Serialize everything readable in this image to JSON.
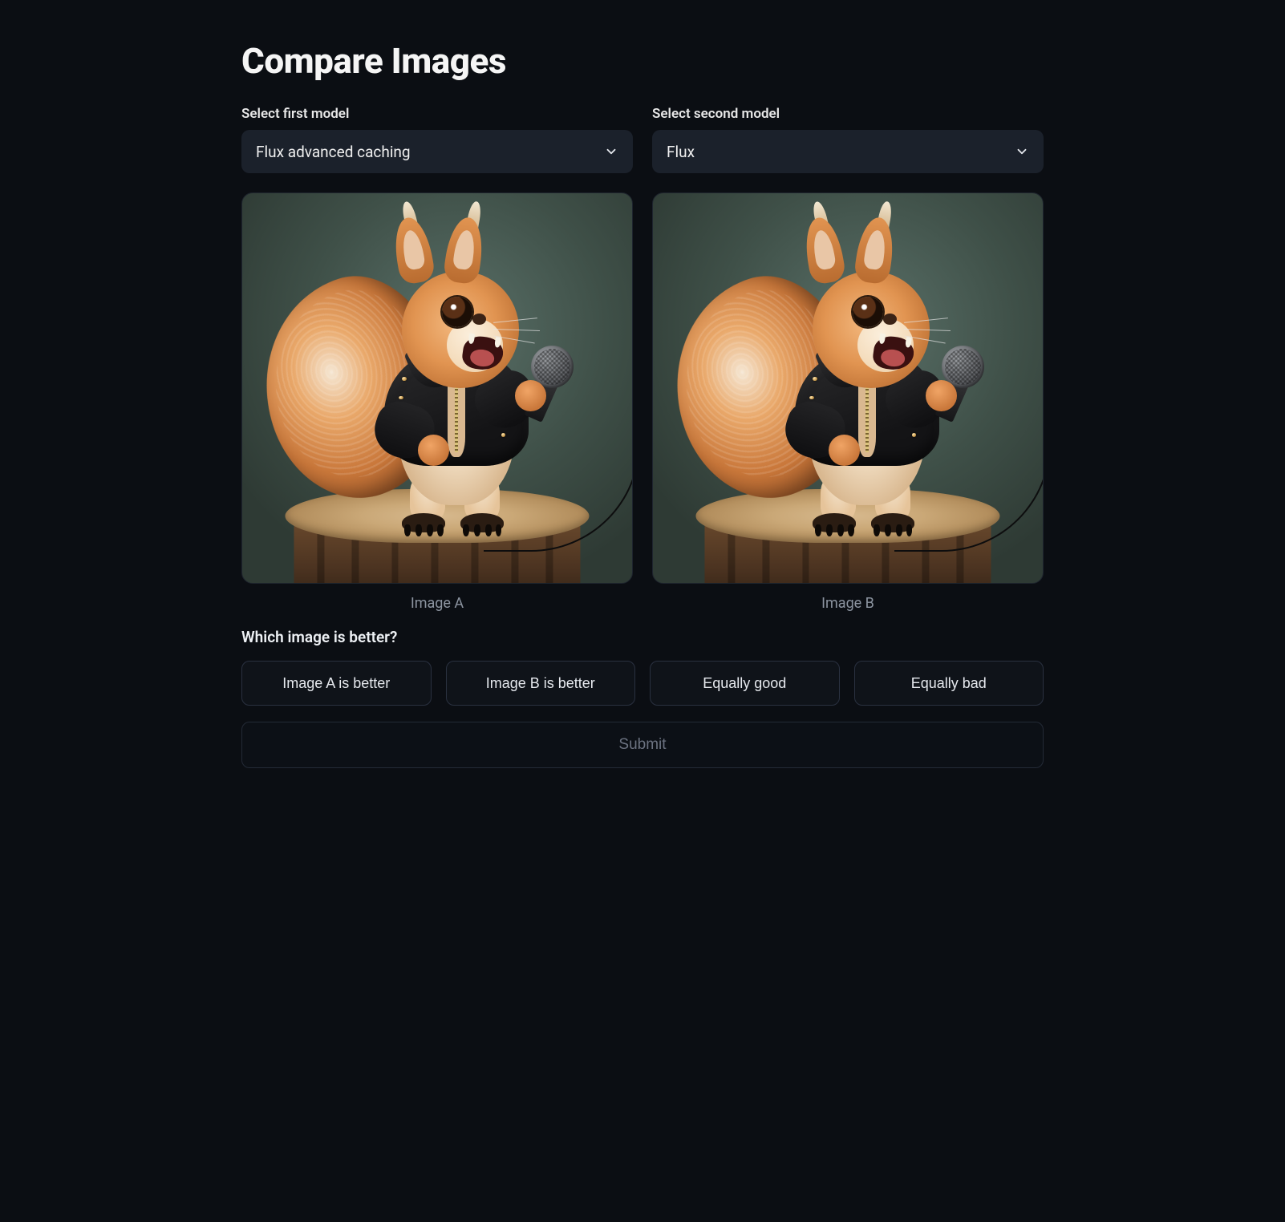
{
  "header": {
    "title": "Compare Images"
  },
  "selectors": {
    "first": {
      "label": "Select first model",
      "value": "Flux advanced caching"
    },
    "second": {
      "label": "Select second model",
      "value": "Flux"
    }
  },
  "images": {
    "a": {
      "caption": "Image A"
    },
    "b": {
      "caption": "Image B"
    }
  },
  "question": "Which image is better?",
  "options": {
    "a_better": "Image A is better",
    "b_better": "Image B is better",
    "eq_good": "Equally good",
    "eq_bad": "Equally bad"
  },
  "submit": {
    "label": "Submit"
  }
}
